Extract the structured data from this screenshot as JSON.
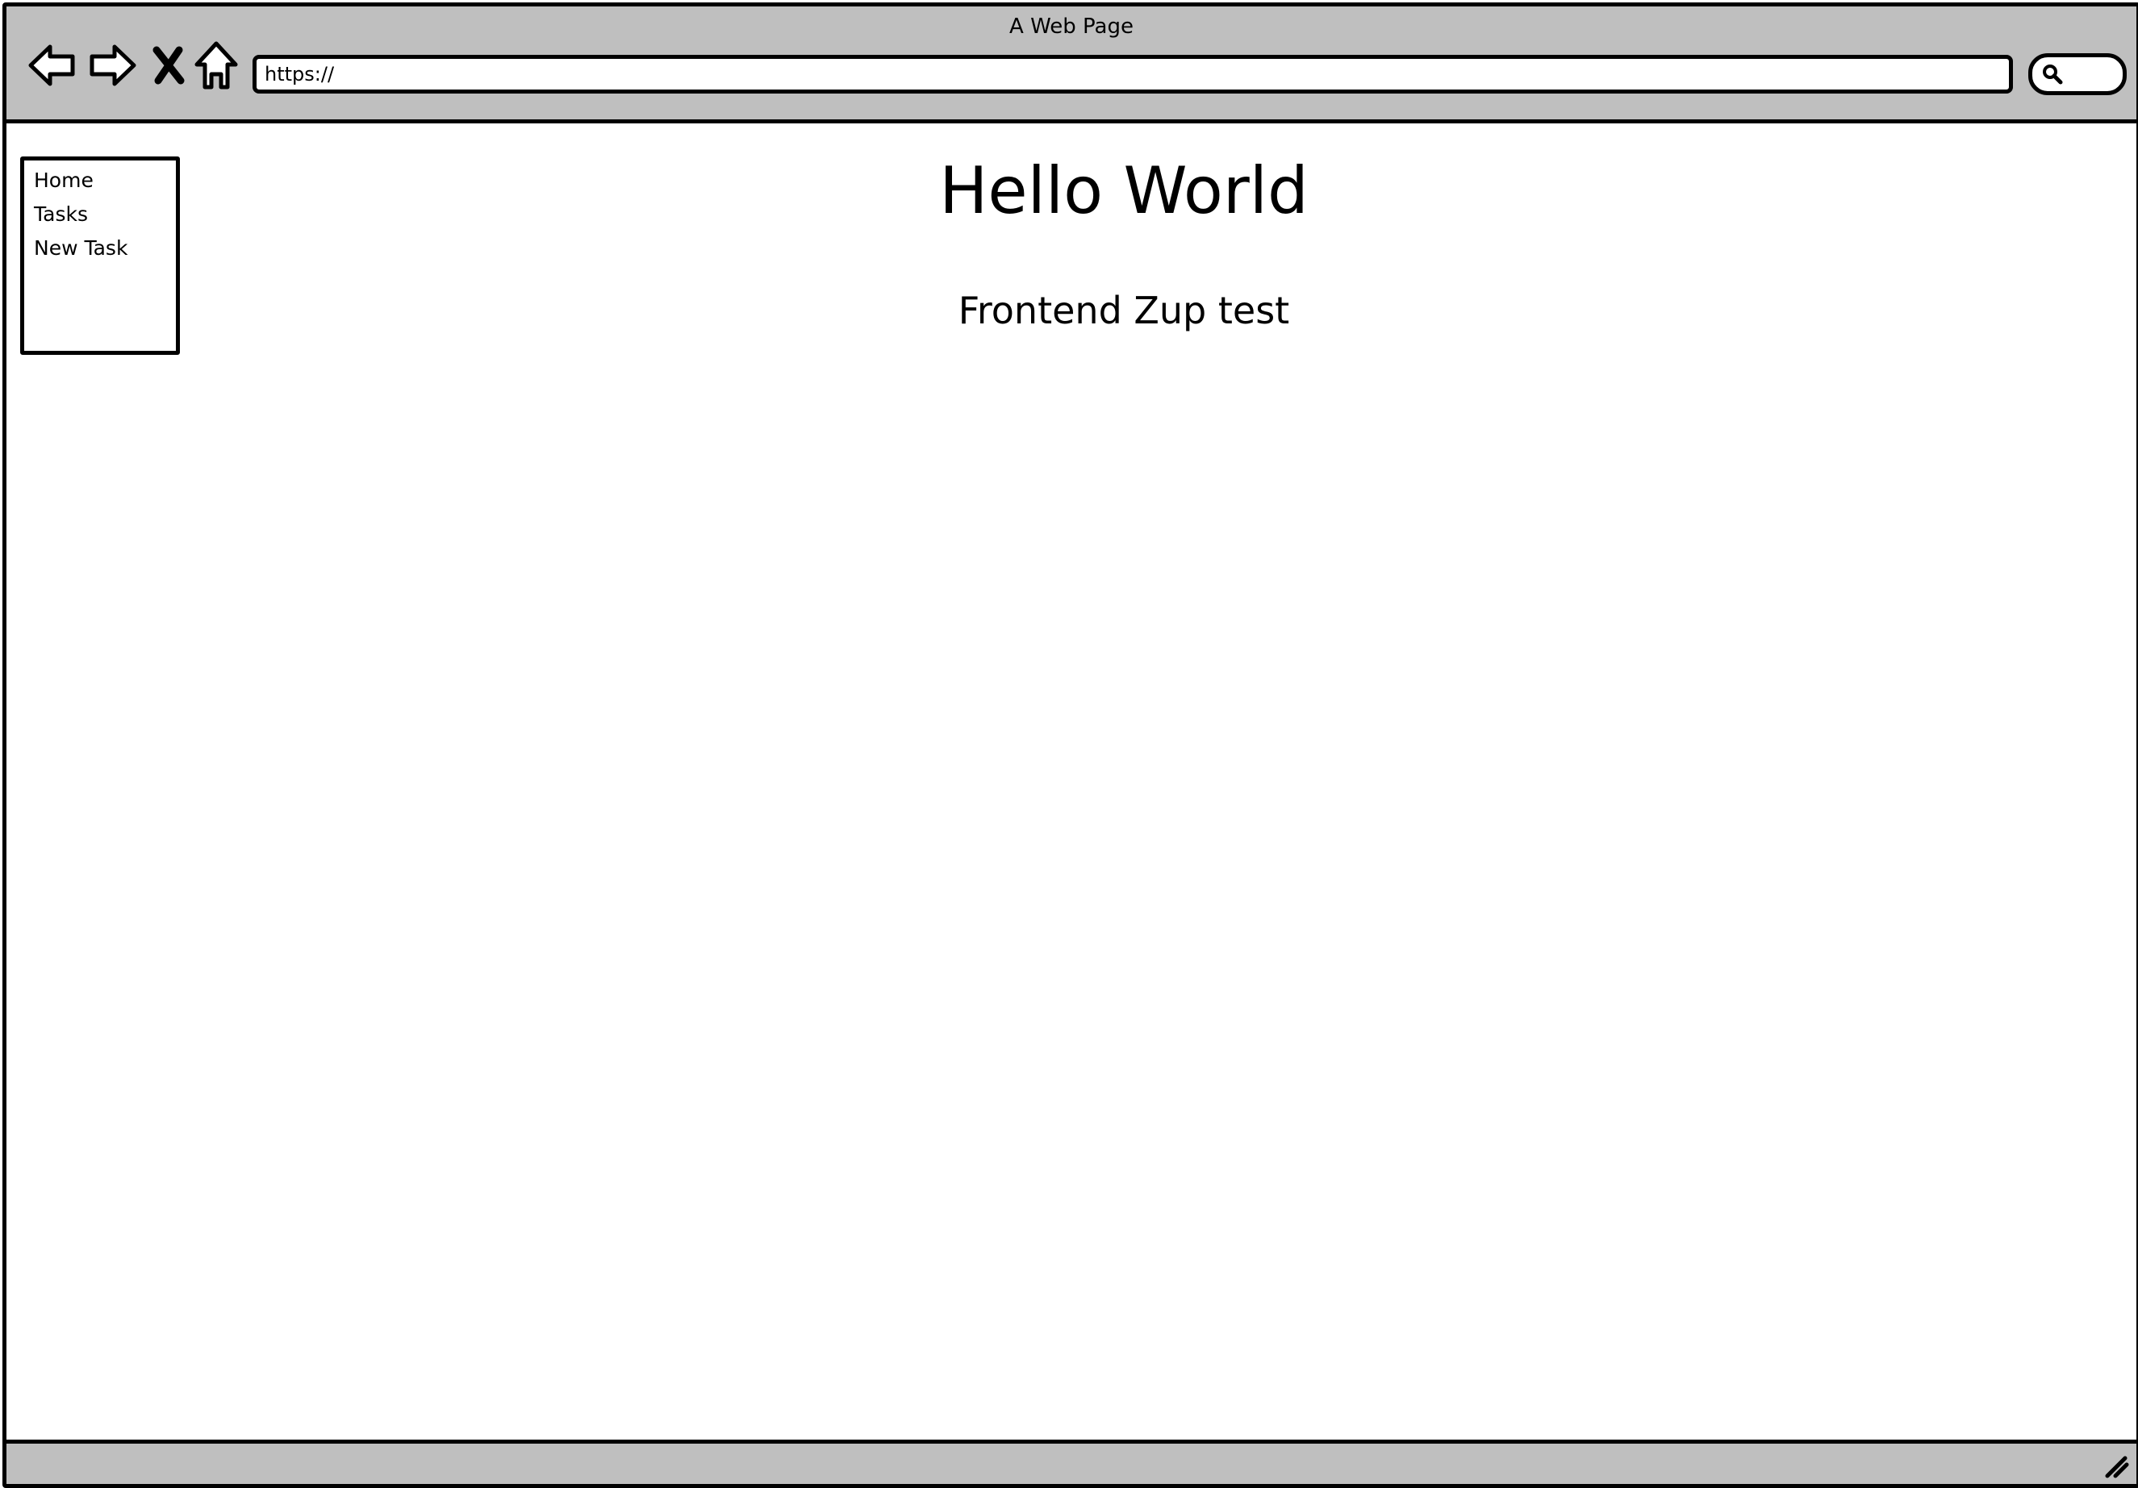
{
  "window": {
    "title": "A Web Page"
  },
  "toolbar": {
    "back_icon": "arrow-left-icon",
    "forward_icon": "arrow-right-icon",
    "stop_icon": "close-x-icon",
    "home_icon": "home-icon",
    "url_value": "https://",
    "search_icon": "search-icon"
  },
  "sidebar": {
    "items": [
      {
        "label": "Home"
      },
      {
        "label": "Tasks"
      },
      {
        "label": "New Task"
      }
    ]
  },
  "main": {
    "title": "Hello World",
    "subtitle": "Frontend Zup test"
  },
  "colors": {
    "chrome_background": "#bfbfbf",
    "content_background": "#ffffff",
    "stroke": "#000000"
  }
}
